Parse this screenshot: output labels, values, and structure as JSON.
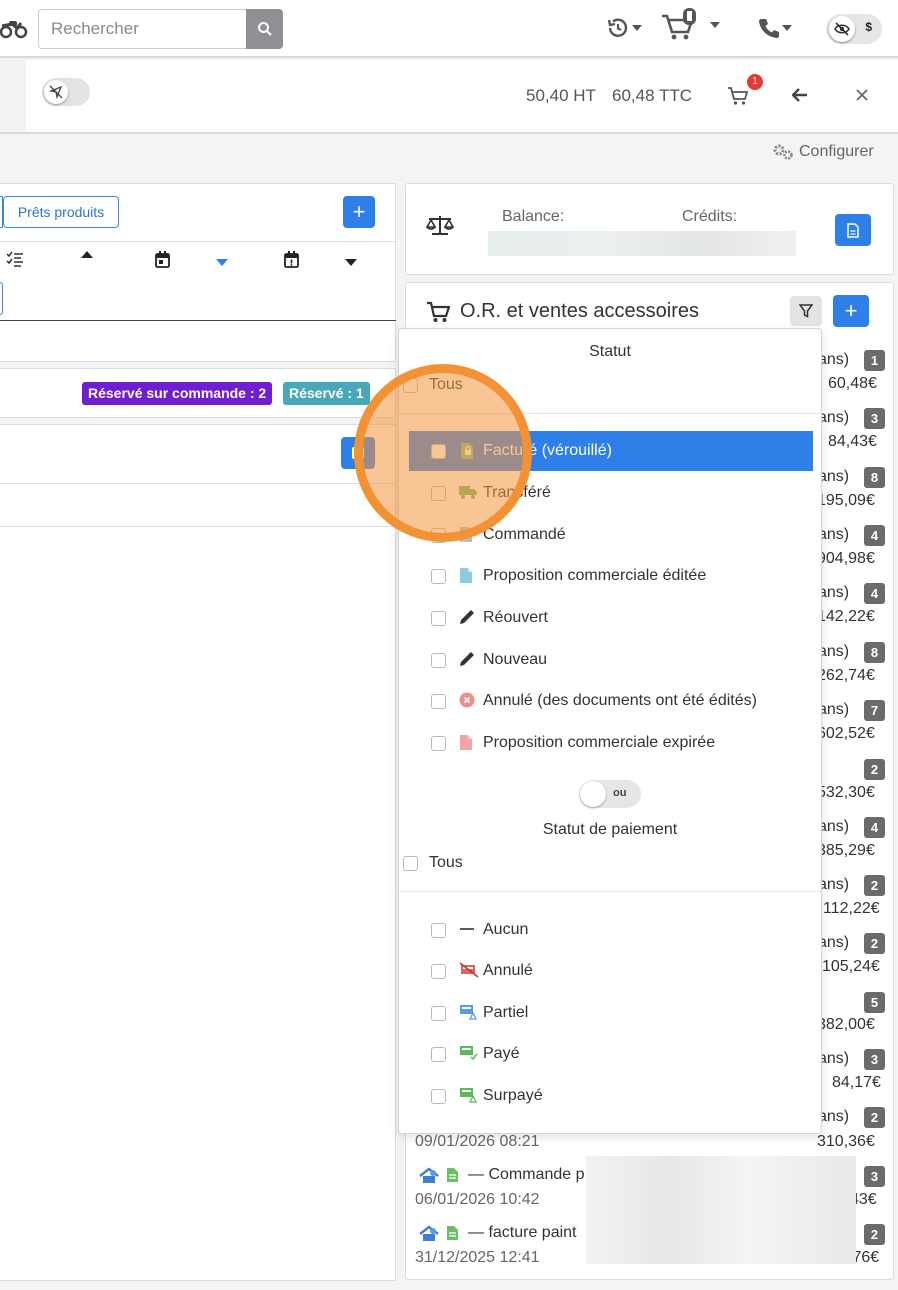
{
  "header": {
    "search_placeholder": "Rechercher",
    "privacy_label": "$"
  },
  "toolbar": {
    "price_ht": "50,40 HT",
    "price_ttc": "60,48 TTC",
    "cart_count": "1"
  },
  "configure_label": "Configurer",
  "left": {
    "tab_label": "Prêts produits",
    "add_label": "+",
    "badge_reserved_order": "Réservé sur commande : 2",
    "badge_reserved": "Réservé : 1"
  },
  "balance": {
    "balance_label": "Balance:",
    "credits_label": "Crédits:"
  },
  "orders": {
    "title": "O.R. et ventes accessoires",
    "add_label": "+",
    "rows": [
      {
        "label": "ans)",
        "count": "1",
        "amount": "60,48€"
      },
      {
        "label": "ans)",
        "count": "3",
        "amount": "84,43€"
      },
      {
        "label": "ans)",
        "count": "8",
        "amount": "195,09€"
      },
      {
        "label": "ans)",
        "count": "4",
        "amount": "904,98€"
      },
      {
        "label": "ans)",
        "count": "4",
        "amount": "142,22€"
      },
      {
        "label": "ans)",
        "count": "8",
        "amount": "262,74€"
      },
      {
        "label": "ans)",
        "count": "7",
        "amount": "602,52€"
      },
      {
        "label": "",
        "count": "2",
        "amount": "532,30€"
      },
      {
        "label": "ans)",
        "count": "4",
        "amount": "385,29€"
      },
      {
        "label": "ans)",
        "count": "2",
        "amount": "112,22€"
      },
      {
        "label": "ans)",
        "count": "2",
        "amount": "105,24€"
      },
      {
        "label": "",
        "count": "5",
        "amount": "382,00€"
      },
      {
        "label": "ans)",
        "count": "3",
        "amount": "84,17€"
      },
      {
        "label": "ans)",
        "count": "2",
        "amount": "310,36€"
      }
    ],
    "row14_date": "09/01/2026 08:21",
    "row15_title": "— Commande p",
    "row15_date": "06/01/2026 10:42",
    "row15_count": "3",
    "row15_amount": "43€",
    "row16_title": "— facture paint",
    "row16_date": "31/12/2025 12:41",
    "row16_count": "2",
    "row16_amount": ",76€"
  },
  "filter": {
    "status_heading": "Statut",
    "all_label": "Tous",
    "status_options": [
      {
        "label": "Facturé (vérouillé)",
        "icon": "invoice-lock-icon",
        "selected": true
      },
      {
        "label": "Transféré",
        "icon": "truck-icon",
        "selected": false
      },
      {
        "label": "Commandé",
        "icon": "document-grey-icon",
        "selected": false
      },
      {
        "label": "Proposition commerciale éditée",
        "icon": "document-blue-icon",
        "selected": false
      },
      {
        "label": "Réouvert",
        "icon": "pencil-icon",
        "selected": false
      },
      {
        "label": "Nouveau",
        "icon": "pencil-icon",
        "selected": false
      },
      {
        "label": "Annulé (des documents ont été édités)",
        "icon": "cancel-circle-icon",
        "selected": false
      },
      {
        "label": "Proposition commerciale expirée",
        "icon": "document-red-icon",
        "selected": false
      }
    ],
    "toggle_label": "ou",
    "payment_heading": "Statut de paiement",
    "payment_all_label": "Tous",
    "payment_options": [
      {
        "label": "Aucun",
        "icon": "dash-icon"
      },
      {
        "label": "Annulé",
        "icon": "payment-cancelled-icon"
      },
      {
        "label": "Partiel",
        "icon": "payment-partial-icon"
      },
      {
        "label": "Payé",
        "icon": "payment-paid-icon"
      },
      {
        "label": "Surpayé",
        "icon": "payment-overpaid-icon"
      }
    ]
  },
  "colors": {
    "primary": "#2f7fe8",
    "purple_badge": "#6f1ed0",
    "teal_badge": "#48a7b8",
    "count_badge": "#6b6b6b",
    "highlight": "#f39234"
  }
}
